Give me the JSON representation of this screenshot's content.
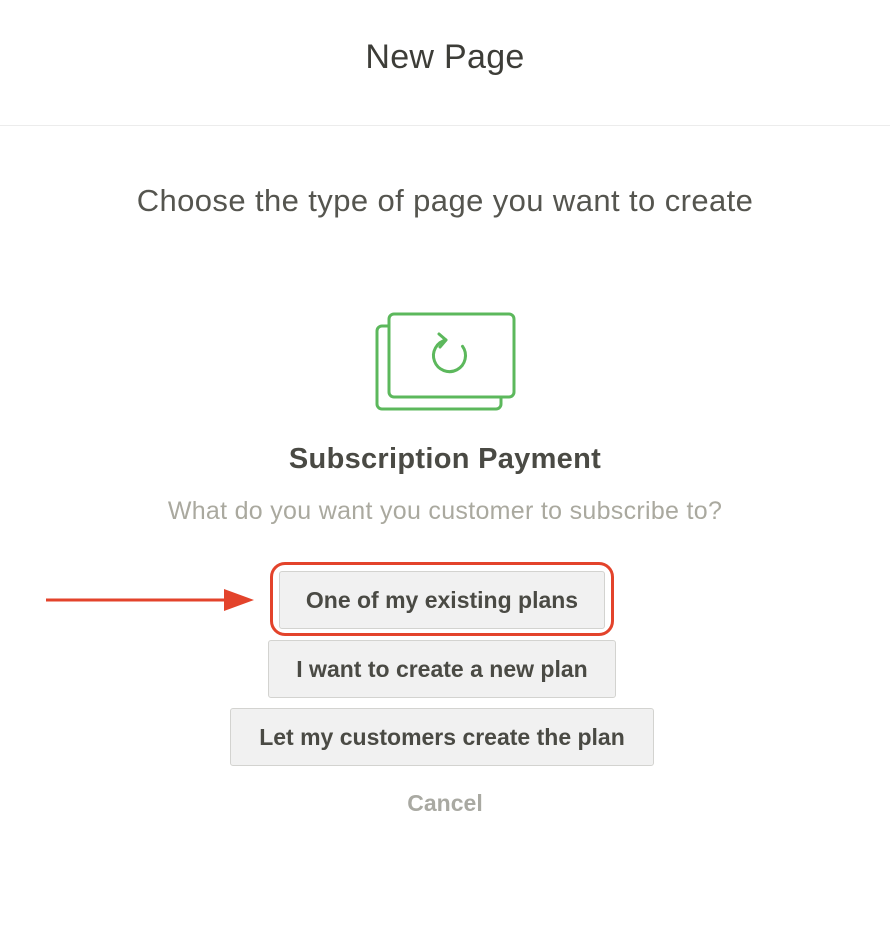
{
  "header": {
    "title": "New Page"
  },
  "prompt": "Choose the type of page you want to create",
  "subscription": {
    "icon": "subscription-cards-icon",
    "icon_color": "#5cb85c",
    "title": "Subscription Payment",
    "subtitle": "What do you want you customer to subscribe to?"
  },
  "options": [
    {
      "label": "One of my existing plans",
      "highlighted": true
    },
    {
      "label": "I want to create a new plan",
      "highlighted": false
    },
    {
      "label": "Let my customers create the plan",
      "highlighted": false
    }
  ],
  "annotation": {
    "color": "#e3432b",
    "arrow_icon": "right-arrow-annotation"
  },
  "cancel_label": "Cancel"
}
